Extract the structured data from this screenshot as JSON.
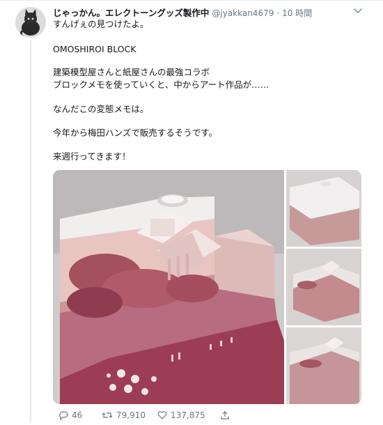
{
  "tweet": {
    "display_name": "じゃっかん。エレクトーングッズ製作中",
    "handle": "@jyakkan4679",
    "separator": "·",
    "time": "10 時間",
    "lines": [
      "すんげぇの見つけたよ。",
      "OMOSHIROI BLOCK",
      "建築模型屋さんと紙屋さんの最強コラボ",
      "ブロックメモを使っていくと、中からアート作品が……",
      "なんだこの変態メモは。",
      "今年から梅田ハンズで販売するそうです。",
      "来週行ってきます！"
    ]
  },
  "actions": {
    "reply_count": "46",
    "retweet_count": "79,910",
    "like_count": "137,875"
  },
  "icons": {
    "more": "chevron-down-icon",
    "reply": "reply-icon",
    "retweet": "retweet-icon",
    "like": "heart-icon",
    "share": "share-icon",
    "avatar": "cat-avatar-icon"
  },
  "colors": {
    "text": "#14171a",
    "secondary": "#657786",
    "divider": "#e1e8ed",
    "memo_pink": "#9c3d55"
  }
}
